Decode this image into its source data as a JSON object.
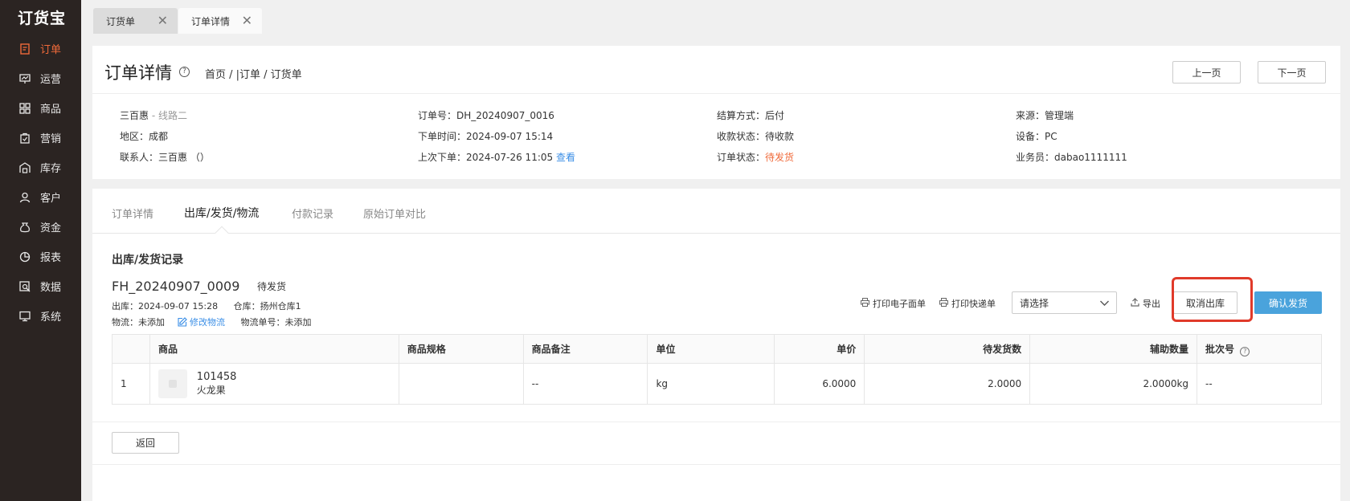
{
  "app": {
    "logo": "订货宝"
  },
  "sidebar": {
    "items": [
      {
        "label": "订单",
        "icon": "order-icon",
        "active": true
      },
      {
        "label": "运营",
        "icon": "operation-icon",
        "active": false
      },
      {
        "label": "商品",
        "icon": "goods-icon",
        "active": false
      },
      {
        "label": "营销",
        "icon": "marketing-icon",
        "active": false
      },
      {
        "label": "库存",
        "icon": "warehouse-icon",
        "active": false
      },
      {
        "label": "客户",
        "icon": "customer-icon",
        "active": false
      },
      {
        "label": "资金",
        "icon": "money-bag-icon",
        "active": false
      },
      {
        "label": "报表",
        "icon": "pie-chart-icon",
        "active": false
      },
      {
        "label": "数据",
        "icon": "data-search-icon",
        "active": false
      },
      {
        "label": "系统",
        "icon": "monitor-icon",
        "active": false
      }
    ]
  },
  "tabs": [
    {
      "label": "订货单"
    },
    {
      "label": "订单详情"
    }
  ],
  "header": {
    "title": "订单详情",
    "breadcrumb": "首页 / |订单 / 订货单",
    "prev_label": "上一页",
    "next_label": "下一页"
  },
  "info": {
    "customer": "三百惠",
    "route": " - 线路二",
    "region": "地区：成都",
    "contact": "联系人：三百惠  （）",
    "order_no": "订单号：DH_20240907_0016",
    "order_time": "下单时间：2024-09-07 15:14",
    "last_order_key": "上次下单：2024-07-26 11:05 ",
    "last_order_link": "查看",
    "settlement": "结算方式：后付",
    "payment_status": "收款状态：待收款",
    "order_status_key": "订单状态：",
    "order_status_value": "待发货",
    "source": "来源：管理端",
    "device": "设备：PC",
    "salesman": "业务员：dabao1111111"
  },
  "subtabs": {
    "detail": "订单详情",
    "shipping": "出库/发货/物流",
    "payments": "付款记录",
    "compare": "原始订单对比"
  },
  "shipment": {
    "section_title": "出库/发货记录",
    "no": "FH_20240907_0009",
    "status": "待发货",
    "out_time": "出库：2024-09-07 15:28",
    "warehouse": "仓库：扬州仓库1",
    "logistics": "物流：未添加",
    "edit_logistics": "修改物流",
    "tracking": "物流单号：未添加"
  },
  "toolbar": {
    "print_e_label": "打印电子面单",
    "print_express_label": "打印快递单",
    "select_placeholder": "请选择",
    "export_label": "导出",
    "cancel_out_label": "取消出库",
    "confirm_ship_label": "确认发货"
  },
  "table": {
    "headers": {
      "goods": "商品",
      "spec": "商品规格",
      "remark": "商品备注",
      "unit": "单位",
      "price": "单价",
      "qty": "待发货数",
      "aux_qty": "辅助数量",
      "batch": "批次号"
    },
    "rows": [
      {
        "index": "1",
        "code": "101458",
        "name": "火龙果",
        "spec": "",
        "remark": "--",
        "unit": "kg",
        "price": "6.0000",
        "qty": "2.0000",
        "aux_qty": "2.0000kg",
        "batch": "--"
      }
    ]
  },
  "footer": {
    "back_label": "返回"
  },
  "colors": {
    "accent": "#f06a3a",
    "primary": "#4aa3dc",
    "highlight": "#e03a2a",
    "sidebar": "#2b2422"
  }
}
